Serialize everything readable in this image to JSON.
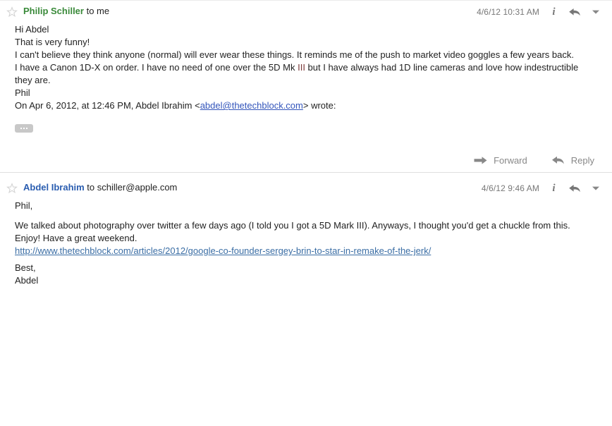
{
  "thread": {
    "messages": [
      {
        "star_icon": "star-outline-icon",
        "sender": "Philip Schiller",
        "sender_color": "#3a8a3a",
        "recipient": " to me",
        "timestamp": "4/6/12 10:31 AM",
        "important_icon": "important-marker-icon",
        "reply_icon": "reply-arrow-icon",
        "more_icon": "chevron-down-icon",
        "body": {
          "greeting": "Hi Abdel",
          "line1": "That is very funny!",
          "line2": "I can't believe they think anyone (normal) will ever wear these things. It reminds me of the push to market video goggles a few years back.",
          "line3_pre": "I have a Canon 1D-X on order. I have no need of one over the 5D Mk ",
          "line3_mk": "III",
          "line3_post": " but I have always had 1D line cameras and love how indestructible they are.",
          "signature": "Phil",
          "quote_pre": "On Apr 6, 2012, at 12:46 PM, Abdel Ibrahim <",
          "quote_email": "abdel@thetechblock.com",
          "quote_post": "> wrote:",
          "trimmed_label": "Show trimmed content"
        },
        "actions": [
          {
            "icon": "forward-arrow-icon",
            "label": "Forward"
          },
          {
            "icon": "reply-arrow-icon",
            "label": "Reply"
          }
        ]
      },
      {
        "star_icon": "star-outline-icon",
        "sender": "Abdel Ibrahim",
        "sender_color": "#2a5db0",
        "recipient": " to schiller@apple.com",
        "timestamp": "4/6/12 9:46 AM",
        "important_icon": "important-marker-icon",
        "reply_icon": "reply-arrow-icon",
        "more_icon": "chevron-down-icon",
        "body": {
          "greeting": "Phil,",
          "line1": "We talked about photography over twitter a few days ago (I told you I got a 5D Mark III). Anyways, I thought you'd get a chuckle from this.",
          "line2": "Enjoy! Have a great weekend.",
          "url": "http://www.thetechblock.com/articles/2012/google-co-founder-sergey-brin-to-star-in-remake-of-the-jerk/",
          "closing": "Best,",
          "signature": "Abdel"
        }
      }
    ]
  },
  "colors": {
    "link": "#3b6ea5",
    "inline_link": "#3355bb",
    "text": "#222222",
    "muted": "#777777",
    "divider": "#e0e0e0",
    "trim_button": "#c8c8c8",
    "mk3_highlight": "#7c3b3b"
  }
}
